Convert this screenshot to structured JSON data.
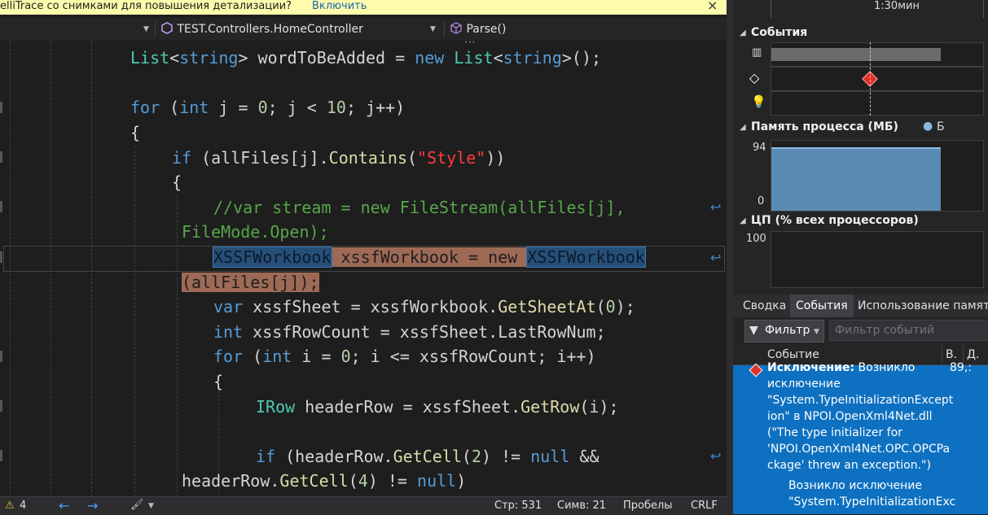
{
  "infobar": {
    "message": "elliTrace со снимками для повышения детализации?",
    "link": "Включить",
    "close": "×"
  },
  "navbar": {
    "class_selector": "TEST.Controllers.HomeController",
    "method_selector": "Parse()"
  },
  "code": {
    "l1_ty1": "List",
    "l1_p1": "<",
    "l1_kw1": "string",
    "l1_p2": "> wordToBeAdded = ",
    "l1_kw2": "new",
    "l1_sp": " ",
    "l1_ty2": "List",
    "l1_p3": "<",
    "l1_kw3": "string",
    "l1_p4": ">();",
    "l2_kw1": "for",
    "l2_p1": " (",
    "l2_kw2": "int",
    "l2_p2": " j = ",
    "l2_n1": "0",
    "l2_p3": "; j < ",
    "l2_n2": "10",
    "l2_p4": "; j++)",
    "l3": "{",
    "l4_kw": "if",
    "l4_p1": " (allFiles[j].",
    "l4_mt": "Contains",
    "l4_p2": "(",
    "l4_str": "\"Style\"",
    "l4_p3": "))",
    "l5": "{",
    "l6a": "//var stream = new FileStream(allFiles[j],",
    "l6b": "FileMode.Open);",
    "l7_ty1": "XSSFWorkbook",
    "l7_mid": " xssfWorkbook = new ",
    "l7_ty2": "XSSFWorkbook",
    "l7b": "(allFiles[j]);",
    "l8_kw": "var",
    "l8_p1": " xssfSheet = xssfWorkbook.",
    "l8_mt": "GetSheetAt",
    "l8_p2": "(",
    "l8_n": "0",
    "l8_p3": ");",
    "l9_kw": "int",
    "l9_p1": " xssfRowCount = xssfSheet.LastRowNum;",
    "l10_kw1": "for",
    "l10_p1": " (",
    "l10_kw2": "int",
    "l10_p2": " i = ",
    "l10_n": "0",
    "l10_p3": "; i <= xssfRowCount; i++)",
    "l11": "{",
    "l12_ty": "IRow",
    "l12_p1": " headerRow = xssfSheet.",
    "l12_mt": "GetRow",
    "l12_p2": "(i);",
    "l13_kw": "if",
    "l13_p1": " (headerRow.",
    "l13_mt": "GetCell",
    "l13_p2": "(",
    "l13_n": "2",
    "l13_p3": ") != ",
    "l13_kw2": "null",
    "l13_p4": " &&",
    "l14_p1": "headerRow.",
    "l14_mt": "GetCell",
    "l14_p2": "(",
    "l14_n": "4",
    "l14_p3": ") != ",
    "l14_kw": "null",
    "l14_p4": ")"
  },
  "statusbar": {
    "warn_count": "4",
    "line": "Стр: 531",
    "col": "Симв: 21",
    "spaces": "Пробелы",
    "eol": "CRLF"
  },
  "diag": {
    "time_label": "1:30мин",
    "events_title": "События",
    "memory_title": "Память процесса (МБ)",
    "memory_legend": "Б",
    "mem_max": "94",
    "mem_min": "0",
    "cpu_title": "ЦП (% всех процессоров)",
    "cpu_max": "100",
    "tabs": [
      "Сводка",
      "События",
      "Использование памяти"
    ],
    "filter_button": "Фильтр",
    "filter_placeholder": "Фильтр событий",
    "col_event": "Событие",
    "col_time": "В.",
    "col_dur": "Д.",
    "event_bold": "Исключение:",
    "event_text1": " Возникло",
    "event_text2": "исключение",
    "event_text3": "\"System.TypeInitializationExcept",
    "event_text4": "ion\" в NPOI.OpenXml4Net.dll",
    "event_text5": "(\"The type initializer for",
    "event_text6": "'NPOI.OpenXml4Net.OPC.OPCPa",
    "event_text7": "ckage' threw an exception.\")",
    "event_time": "89,:",
    "sub_text1": "Возникло исключение",
    "sub_text2": "\"System.TypeInitializationExc"
  },
  "colors": {
    "accent": "#0e70c0",
    "editor_bg": "#1e1e1e",
    "infobar": "#fdfbac",
    "memory_fill": "#5b8bb2"
  }
}
